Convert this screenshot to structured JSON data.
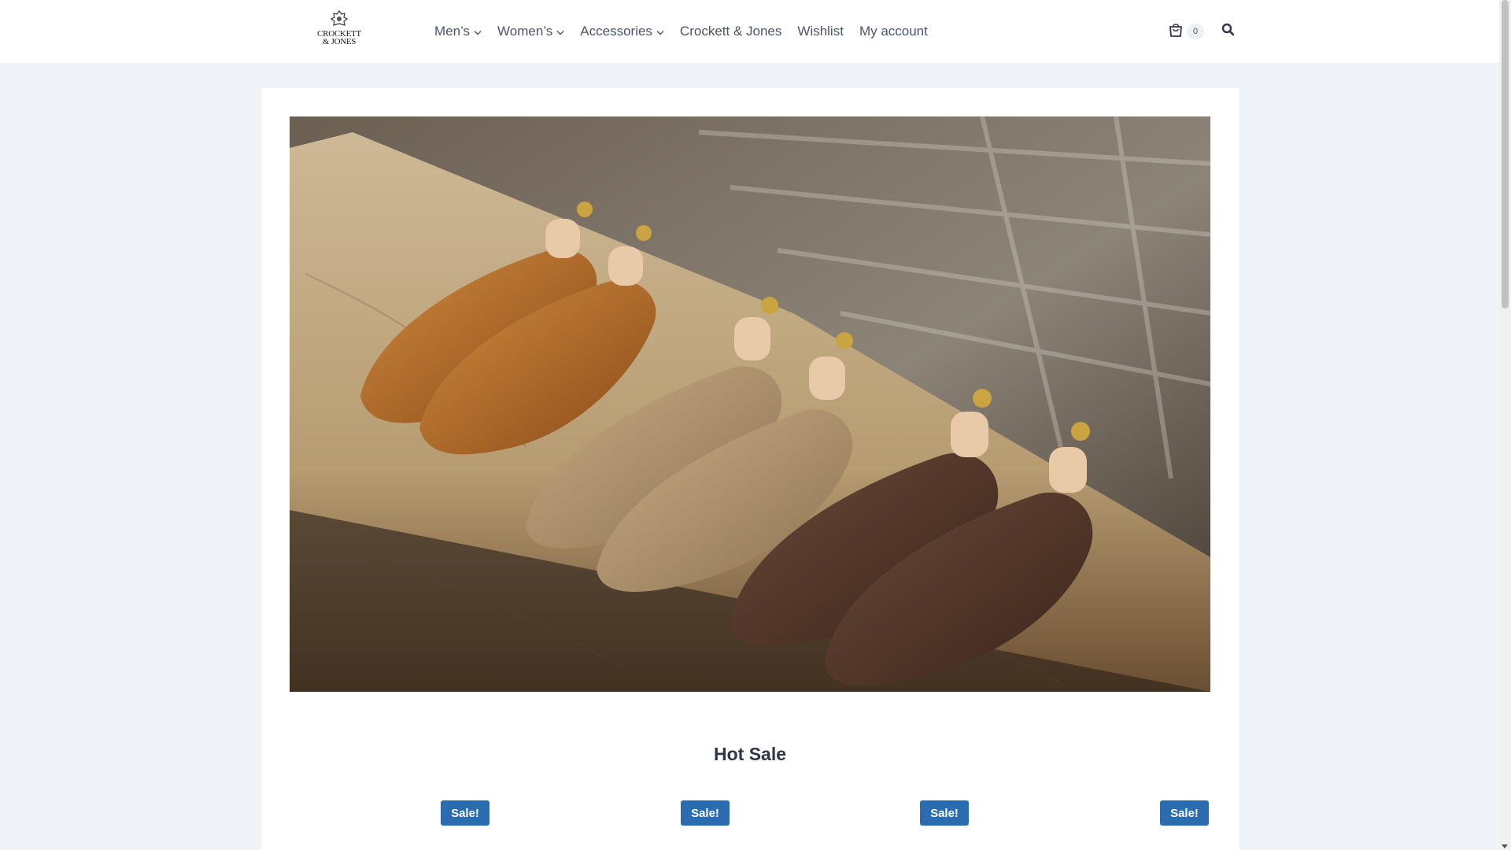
{
  "brand": {
    "logo_line1": "CROCKETT",
    "logo_line2": "& JONES"
  },
  "nav": {
    "items": [
      {
        "label": "Men’s",
        "has_dropdown": true
      },
      {
        "label": "Women’s",
        "has_dropdown": true
      },
      {
        "label": "Accessories",
        "has_dropdown": true
      },
      {
        "label": "Crockett & Jones",
        "has_dropdown": false
      },
      {
        "label": "Wishlist",
        "has_dropdown": false
      },
      {
        "label": "My account",
        "has_dropdown": false
      }
    ]
  },
  "header_tools": {
    "cart_icon": "shopping-bag-icon",
    "cart_count": "0",
    "search_icon": "search-icon"
  },
  "hero": {
    "image_subject": "three pairs of penny loafers on a worn wooden bench"
  },
  "section": {
    "title": "Hot Sale"
  },
  "products": [
    {
      "badge": "Sale!"
    },
    {
      "badge": "Sale!"
    },
    {
      "badge": "Sale!"
    },
    {
      "badge": "Sale!"
    }
  ],
  "colors": {
    "accent": "#2b6cb0",
    "page_bg": "#f0f4f8",
    "nav_text": "#4a5568"
  }
}
